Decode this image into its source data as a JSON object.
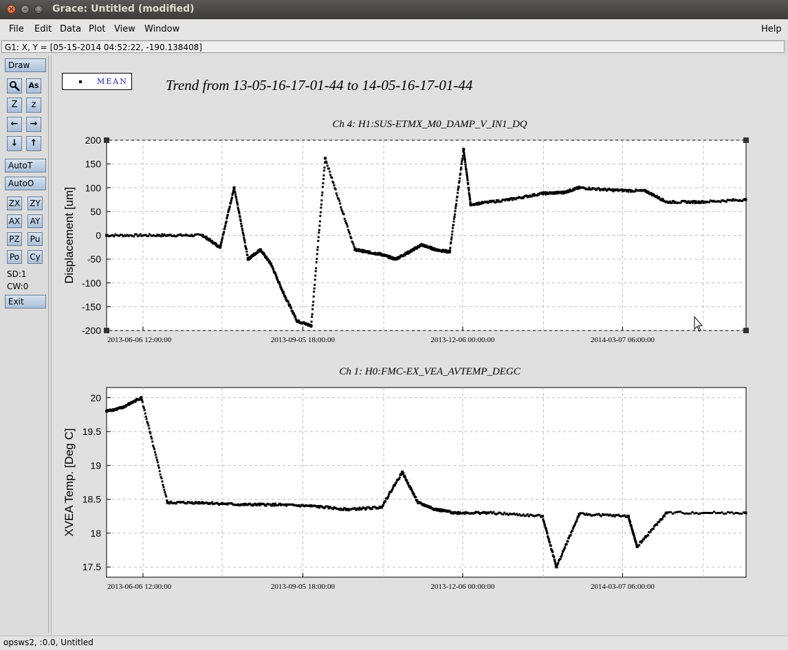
{
  "window": {
    "title": "Grace: Untitled (modified)"
  },
  "menu": {
    "file": "File",
    "edit": "Edit",
    "data": "Data",
    "plot": "Plot",
    "view": "View",
    "window": "Window",
    "help": "Help"
  },
  "coord_readout": "G1: X, Y = [05-15-2014 04:52:22, -190.138408]",
  "toolbar": {
    "draw": "Draw",
    "autot": "AutoT",
    "autoo": "AutoO",
    "exit": "Exit",
    "zoom_in": "Z",
    "zoom_out": "z",
    "zx": "ZX",
    "zy": "ZY",
    "ax": "AX",
    "ay": "AY",
    "pz": "PZ",
    "pu": "Pu",
    "po": "Po",
    "cy": "Cy",
    "sd": "SD:1",
    "cw": "CW:0"
  },
  "legend": {
    "label": "MEAN"
  },
  "page_title": "Trend from 13-05-16-17-01-44 to 14-05-16-17-01-44",
  "status": "opsws2, :0.0, Untitled",
  "icons": [
    "magnifier-icon",
    "autoscale-text-icon",
    "arrow-left-icon",
    "arrow-right-icon",
    "arrow-down-icon",
    "arrow-up-icon",
    "mouse-cursor-icon"
  ],
  "chart_data": [
    {
      "type": "scatter",
      "title": "Ch 4: H1:SUS-ETMX_M0_DAMP_V_IN1_DQ",
      "xlabel": "",
      "ylabel": "Displacement [um]",
      "ylim": [
        -200,
        200
      ],
      "yticks": [
        200,
        150,
        100,
        50,
        0,
        -50,
        -100,
        -150,
        -200
      ],
      "xtick_labels": [
        "2013-06-06 12:00:00",
        "2013-09-05 18:00:00",
        "2013-12-06 00:00:00",
        "2014-03-07 06:00:00"
      ],
      "grid": "dashed",
      "series": [
        {
          "name": "MEAN",
          "x": [
            "2013-05-16",
            "2013-06-15",
            "2013-07-10",
            "2013-07-20",
            "2013-07-28",
            "2013-08-05",
            "2013-08-12",
            "2013-08-18",
            "2013-08-25",
            "2013-09-02",
            "2013-09-10",
            "2013-09-18",
            "2013-10-05",
            "2013-10-12",
            "2013-10-20",
            "2013-10-28",
            "2013-11-05",
            "2013-11-12",
            "2013-11-20",
            "2013-11-28",
            "2013-12-06",
            "2013-12-10",
            "2014-01-01",
            "2014-01-20",
            "2014-02-01",
            "2014-02-10",
            "2014-03-01",
            "2014-03-20",
            "2014-04-01",
            "2014-04-20",
            "2014-05-16"
          ],
          "values": [
            0,
            0,
            0,
            -25,
            100,
            -50,
            -30,
            -60,
            -120,
            -180,
            -190,
            162,
            -30,
            -35,
            -40,
            -50,
            -35,
            -20,
            -30,
            -35,
            180,
            65,
            75,
            88,
            90,
            100,
            95,
            93,
            70,
            70,
            75
          ]
        }
      ]
    },
    {
      "type": "scatter",
      "title": "Ch 1: H0:FMC-EX_VEA_AVTEMP_DEGC",
      "xlabel": "",
      "ylabel": "XVEA Temp. [Deg C]",
      "ylim": [
        17.35,
        20.15
      ],
      "yticks": [
        20,
        19.5,
        19,
        18.5,
        18,
        17.5
      ],
      "xtick_labels": [
        "2013-06-06 12:00:00",
        "2013-09-05 18:00:00",
        "2013-12-06 00:00:00",
        "2014-03-07 06:00:00"
      ],
      "grid": "dashed",
      "series": [
        {
          "name": "MEAN",
          "x": [
            "2013-05-16",
            "2013-05-25",
            "2013-06-05",
            "2013-06-20",
            "2013-07-10",
            "2013-08-01",
            "2013-08-20",
            "2013-09-10",
            "2013-10-01",
            "2013-10-20",
            "2013-11-01",
            "2013-11-10",
            "2013-11-20",
            "2013-12-01",
            "2013-12-20",
            "2014-01-20",
            "2014-01-28",
            "2014-02-10",
            "2014-03-10",
            "2014-03-15",
            "2014-04-01",
            "2014-05-16"
          ],
          "values": [
            19.8,
            19.85,
            20.0,
            18.45,
            18.45,
            18.42,
            18.42,
            18.4,
            18.35,
            18.38,
            18.9,
            18.45,
            18.35,
            18.3,
            18.3,
            18.25,
            17.5,
            18.28,
            18.25,
            17.8,
            18.3,
            18.3
          ]
        }
      ]
    }
  ]
}
